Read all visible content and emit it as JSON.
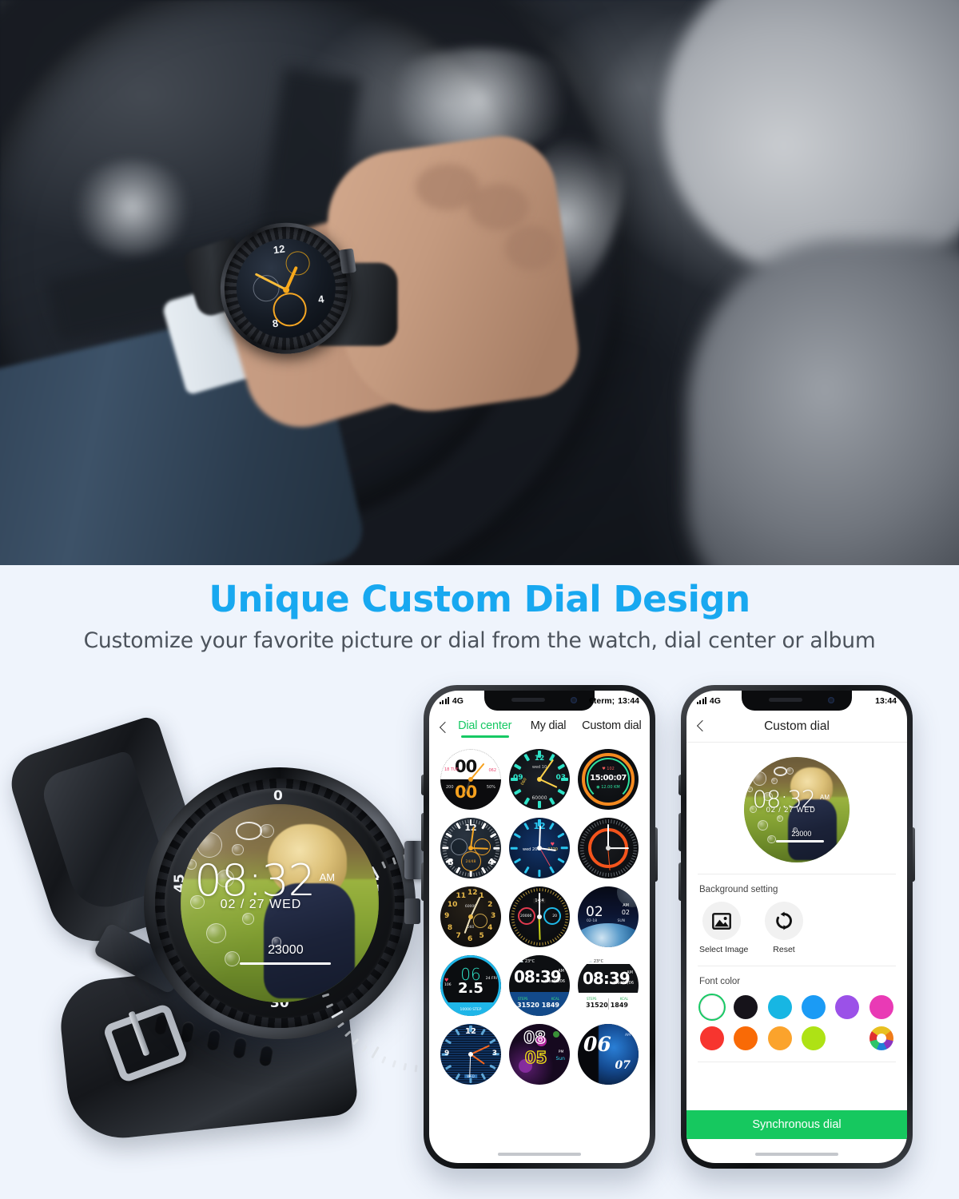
{
  "hero": {
    "alt": "Man driving car wearing black smartwatch",
    "watch_face": {
      "numerals": [
        "12",
        "4",
        "8"
      ],
      "accent_color": "#f7a81b"
    }
  },
  "headline": {
    "title": "Unique Custom Dial Design",
    "subtitle": "Customize your favorite picture or dial from the watch, dial center or album",
    "title_color": "#18a8f0",
    "subtitle_color": "#4c535c"
  },
  "product_watch": {
    "bezel_labels": [
      "0",
      "15",
      "30",
      "45"
    ],
    "dial": {
      "time": "08:32",
      "ampm": "AM",
      "date": "02 / 27 WED",
      "steps": "23000"
    }
  },
  "phone1": {
    "status_bar": {
      "network": "4G",
      "bluetooth_icon": "bluetooth-icon",
      "time": "13:44"
    },
    "back_icon": "back-chevron-icon",
    "tabs": [
      {
        "label": "Dial center",
        "active": true
      },
      {
        "label": "My dial",
        "active": false
      },
      {
        "label": "Custom dial",
        "active": false
      }
    ],
    "active_tab_color": "#17c964",
    "watch_faces": [
      {
        "id": "wf-1",
        "name": "dual-digit-orange",
        "primary": "00",
        "secondary": "00",
        "left_meta": "18 TUE",
        "right_meta": "062",
        "extra1": "200",
        "extra2": "50%"
      },
      {
        "id": "wf-2",
        "name": "teal-analog-markers",
        "top": "12",
        "left": "09",
        "right": "03",
        "date": "wed 10",
        "steps": "60000",
        "sub": "060"
      },
      {
        "id": "wf-3",
        "name": "orange-ring-digital",
        "primary": "15:00:07",
        "meta": "12.00 KM",
        "hr": "102"
      },
      {
        "id": "wf-4",
        "name": "chrono-orange",
        "top": "12",
        "left": "8",
        "right": "4",
        "sub": "24/48"
      },
      {
        "id": "wf-5",
        "name": "blue-sport-analog",
        "top": "12",
        "date": "wed 20",
        "steps": "3320"
      },
      {
        "id": "wf-6",
        "name": "orange-circle-compass"
      },
      {
        "id": "wf-7",
        "name": "gold-numerals-classic",
        "numbers": "12 11 10 9 8 7 6 5 4 3 2 1",
        "steps": "60000",
        "hr": "060"
      },
      {
        "id": "wf-8",
        "name": "dual-subdial-red-blue",
        "time": "14:4",
        "left_val": "20000",
        "right_val": "20"
      },
      {
        "id": "wf-9",
        "name": "earth-space-digital",
        "primary": "02",
        "minutes": "02",
        "ampm": "AM",
        "date": "02-18",
        "day": "SUN"
      },
      {
        "id": "wf-10",
        "name": "cyan-big-digit",
        "primary": "06",
        "secondary": "2.5",
        "hr": "106",
        "date": "24 FRI",
        "steps": "10000 STEP"
      },
      {
        "id": "wf-11",
        "name": "blue-weather-steps",
        "time": "08:39",
        "ampm": "AM",
        "date": "Wed03/06",
        "temp": "23°C",
        "steps_label": "STEPS",
        "steps": "31520",
        "kcal_label": "KCAL",
        "kcal": "1849"
      },
      {
        "id": "wf-12",
        "name": "white-weather-steps",
        "time": "08:39",
        "ampm": "AM",
        "date": "Wed03/06",
        "temp": "23°C",
        "steps_label": "STEPS",
        "steps": "31520",
        "kcal_label": "KCAL",
        "kcal": "1849"
      },
      {
        "id": "wf-13",
        "name": "blue-stripe-analog",
        "top": "12",
        "left": "9",
        "right": "3",
        "day": "WED"
      },
      {
        "id": "wf-14",
        "name": "bokeh-outline-digit",
        "primary": "08",
        "secondary": "05",
        "ampm": "PM",
        "day": "Sun"
      },
      {
        "id": "wf-15",
        "name": "brush-stroke-digit",
        "primary": "06",
        "secondary": "07",
        "ampm": "AM"
      }
    ]
  },
  "phone2": {
    "status_bar": {
      "network": "4G",
      "bluetooth_icon": "bluetooth-icon",
      "time": "13:44"
    },
    "back_icon": "back-chevron-icon",
    "title": "Custom dial",
    "preview": {
      "time": "08:32",
      "ampm": "AM",
      "date": "02 / 27 WED",
      "steps": "23000"
    },
    "background_setting": {
      "label": "Background setting",
      "actions": [
        {
          "label": "Select Image",
          "icon": "image-icon"
        },
        {
          "label": "Reset",
          "icon": "refresh-icon"
        }
      ]
    },
    "font_color": {
      "label": "Font color",
      "swatches": [
        {
          "name": "white",
          "hex": "#ffffff",
          "selected": true
        },
        {
          "name": "black",
          "hex": "#16131a",
          "selected": false
        },
        {
          "name": "cyan",
          "hex": "#17b6e3",
          "selected": false
        },
        {
          "name": "blue",
          "hex": "#1b9bf5",
          "selected": false
        },
        {
          "name": "purple",
          "hex": "#9b51e8",
          "selected": false
        },
        {
          "name": "magenta",
          "hex": "#e93ab5",
          "selected": false
        },
        {
          "name": "red",
          "hex": "#f7352f",
          "selected": false
        },
        {
          "name": "orange-red",
          "hex": "#f96a06",
          "selected": false
        },
        {
          "name": "orange",
          "hex": "#fba32c",
          "selected": false
        },
        {
          "name": "lime",
          "hex": "#aee215",
          "selected": false
        },
        {
          "name": "green",
          "hex": "#2bd island",
          "selected": false
        },
        {
          "name": "rainbow",
          "hex": "rainbow",
          "selected": false
        }
      ]
    },
    "sync_button": {
      "label": "Synchronous dial",
      "color": "#16c85f"
    }
  }
}
